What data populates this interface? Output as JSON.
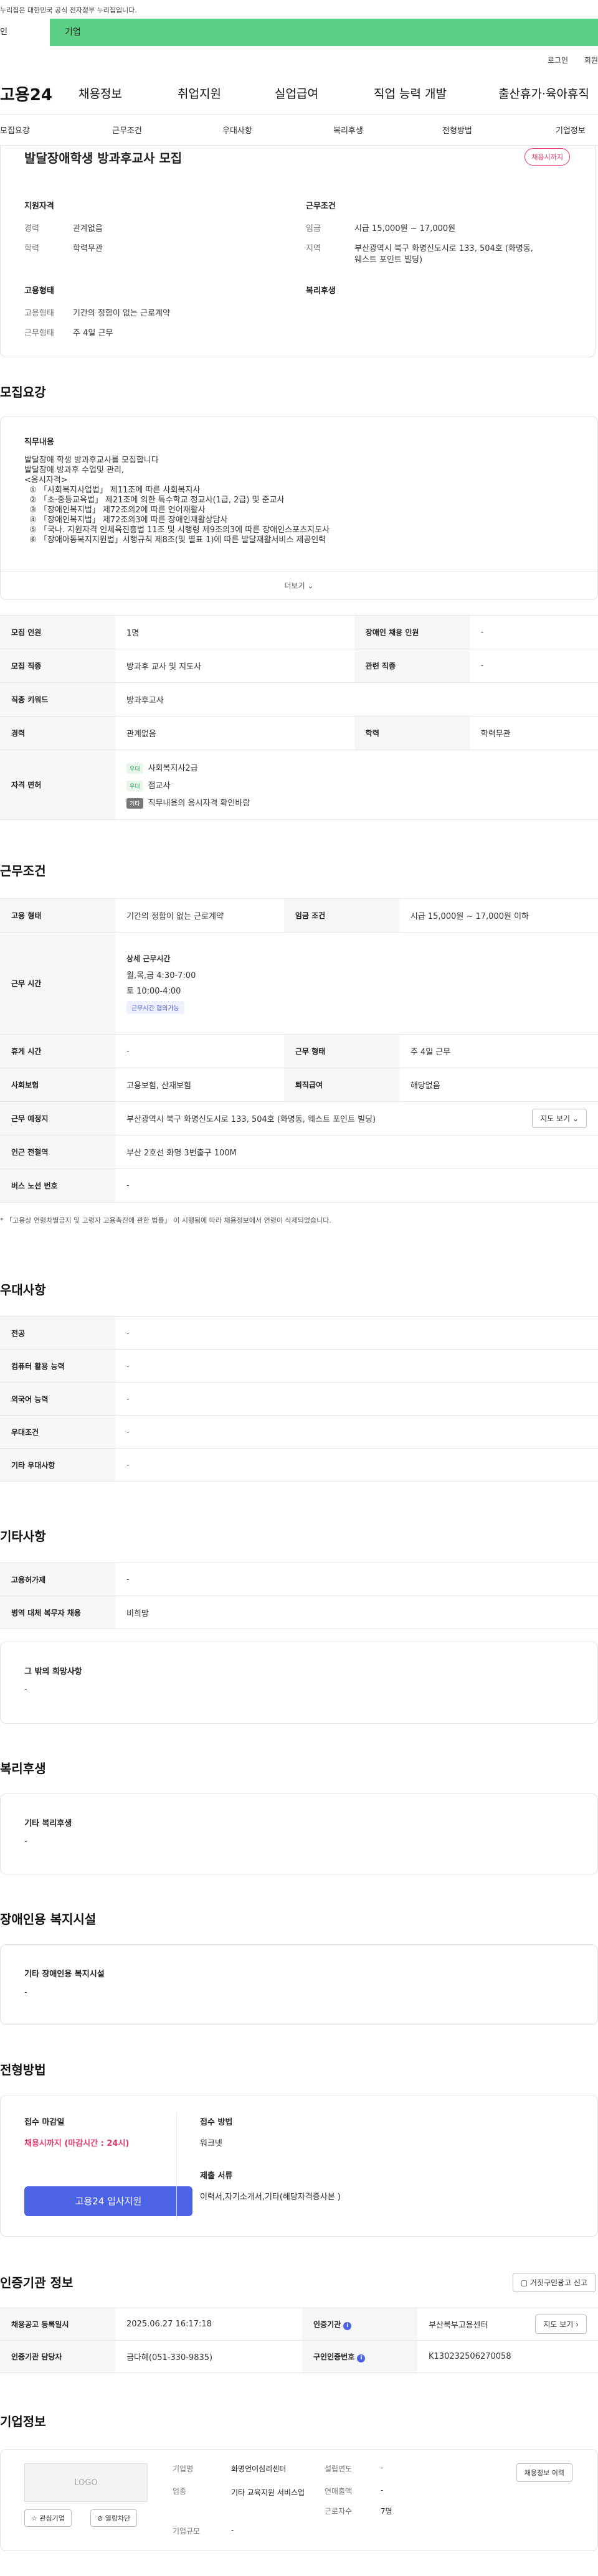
{
  "top_notice": "누리집은 대한민국 공식 전자정부 누리집입니다.",
  "user_tabs": {
    "individual": "인",
    "business": "기업"
  },
  "util_links": [
    "로그인",
    "회원"
  ],
  "gnb": {
    "logo": "고용24",
    "menus": [
      "채용정보",
      "취업지원",
      "실업급여",
      "직업 능력 개발",
      "출산휴가·육아휴직"
    ]
  },
  "sub_tabs": [
    "모집요강",
    "근무조건",
    "우대사항",
    "복리후생",
    "전형방법",
    "기업정보"
  ],
  "summary": {
    "title": "발달장애학생 방과후교사 모집",
    "status_badge": "채용시까지",
    "qualification": {
      "heading": "지원자격",
      "rows": [
        {
          "k": "경력",
          "v": "관계없음"
        },
        {
          "k": "학력",
          "v": "학력무관"
        }
      ]
    },
    "conditions": {
      "heading": "근무조건",
      "rows": [
        {
          "k": "임금",
          "v": "시급 15,000원 ~ 17,000원"
        },
        {
          "k": "지역",
          "v": "부산광역시 북구 화명신도시로 133, 504호 (화명동, 웨스트 포인트 빌딩)"
        }
      ]
    },
    "employment": {
      "heading": "고용형태",
      "rows": [
        {
          "k": "고용형태",
          "v": "기간의 정함이 없는 근로계약"
        },
        {
          "k": "근무형태",
          "v": "주 4일 근무"
        }
      ]
    },
    "welfare_heading": "복리후생"
  },
  "recruit": {
    "section_title": "모집요강",
    "duty_heading": "직무내용",
    "duty_lines": [
      "발달장애 학생 방과후교사를 모집합니다",
      "발달장애 방과후 수업및 관리,",
      "<응시자격>",
      "  ① 「사회복지사업법」 제11조에 따른 사회복지사",
      "  ② 「초·중등교육법」 제21조에 의한 특수학교 정교사(1급, 2급) 및 준교사",
      "  ③ 「장애인복지법」 제72조의2에 따른 언어재활사",
      "  ④ 「장애인복지법」 제72조의3에 따른 장애인재활상담사",
      "  ⑤ 「국나. 지원자격 인체육진흥법 11조 및 시행령 제9조의3에 따른 장애인스포츠지도사",
      "  ⑥ 「장애아동복지지원법」시행규칙 제8조(및 별표 1)에 따른 발달재활서비스 제공인력"
    ],
    "more_label": "더보기",
    "table": {
      "headcount_label": "모집 인원",
      "headcount": "1명",
      "disabled_label": "장애인 채용 인원",
      "disabled": "-",
      "job_label": "모집 직종",
      "job": "방과후 교사 및 지도사",
      "related_label": "관련 직종",
      "related": "-",
      "keyword_label": "직종 키워드",
      "keyword": "방과후교사",
      "career_label": "경력",
      "career": "관계없음",
      "edu_label": "학력",
      "edu": "학력무관",
      "license_label": "자격 면허",
      "licenses": [
        {
          "tag": "우대",
          "name": "사회복지사2급"
        },
        {
          "tag": "우대",
          "name": "점교사"
        },
        {
          "tag": "기타",
          "name": "직무내용의 응시자격 확인바람"
        }
      ]
    }
  },
  "work": {
    "section_title": "근무조건",
    "type_label": "고용 형태",
    "type": "기간의 정함이 없는 근로계약",
    "wage_label": "임금 조건",
    "wage": "시급 15,000원 ~ 17,000원 이하",
    "hours_label": "근무 시간",
    "hours_heading": "상세 근무시간",
    "hours_lines": [
      "월,목,금 4:30-7:00",
      "토 10:00-4:00"
    ],
    "hours_tag": "근무시간 협의가능",
    "rest_label": "휴게 시간",
    "rest": "-",
    "shift_label": "근무 형태",
    "shift": "주 4일 근무",
    "insurance_label": "사회보험",
    "insurance": "고용보험, 산재보험",
    "severance_label": "퇴직급여",
    "severance": "해당없음",
    "location_label": "근무 예정지",
    "location": "부산광역시 북구 화명신도시로 133, 504호 (화명동, 웨스트 포인트 빌딩)",
    "map_button": "지도 보기",
    "subway_label": "인근 전철역",
    "subway": "부산 2호선 화명 3번출구 100M",
    "bus_label": "버스 노선 번호",
    "bus": "-",
    "note": "「고용상 연령차별금지 및 고령자 고용촉진에 관한 법률」 이 시행됨에 따라 채용정보에서 연령이 삭제되었습니다."
  },
  "preference": {
    "section_title": "우대사항",
    "rows": [
      {
        "k": "전공",
        "v": "-"
      },
      {
        "k": "컴퓨터 활용 능력",
        "v": "-"
      },
      {
        "k": "외국어 능력",
        "v": "-"
      },
      {
        "k": "우대조건",
        "v": "-"
      },
      {
        "k": "기타 우대사항",
        "v": "-"
      }
    ]
  },
  "etc": {
    "section_title": "기타사항",
    "rows": [
      {
        "k": "고용허가제",
        "v": "-"
      },
      {
        "k": "병역 대체 복무자 채용",
        "v": "비희망"
      }
    ],
    "other_heading": "그 밖의 희망사항",
    "other_value": "-"
  },
  "welfare": {
    "section_title": "복리후생",
    "heading": "기타 복리후생",
    "value": "-"
  },
  "disabled_facility": {
    "section_title": "장애인용 복지시설",
    "heading": "기타 장애인용 복지시설",
    "value": "-"
  },
  "selection": {
    "section_title": "전형방법",
    "deadline_label": "접수 마감일",
    "deadline": "채용시까지 (마감시간 : 24시)",
    "apply_button": "고용24 입사지원",
    "method_label": "접수 방법",
    "method": "워크넷",
    "docs_label": "제출 서류",
    "docs": "이력서,자기소개서,기타(해당자격증사본 )"
  },
  "agency": {
    "section_title": "인증기관 정보",
    "report_button": "거짓구인광고 신고",
    "reg_date_label": "채용공고 등록일시",
    "reg_date": "2025.06.27 16:17:18",
    "org_label": "인증기관",
    "org": "부산북부고용센터",
    "map_button": "지도 보기",
    "manager_label": "인증기관 담당자",
    "manager": "금다혜(051-330-9835)",
    "number_label": "구인인증번호",
    "number": "K130232506270058"
  },
  "company": {
    "section_title": "기업정보",
    "logo_text": "LOGO",
    "interest_button": "관심기업",
    "block_button": "열람차단",
    "name_label": "기업명",
    "name": "화명언어심리센터",
    "industry_label": "업종",
    "industry": "기타 교육지원 서비스업",
    "size_label": "기업규모",
    "size": "-",
    "founded_label": "설립연도",
    "founded": "-",
    "sales_label": "연매출액",
    "sales": "-",
    "employees_label": "근로자수",
    "employees": "7명",
    "jobs_button": "채용정보 이력"
  },
  "colors": {
    "accent": "#4c63e6",
    "brand_green": "#5ad086",
    "alert": "#e4386c"
  }
}
